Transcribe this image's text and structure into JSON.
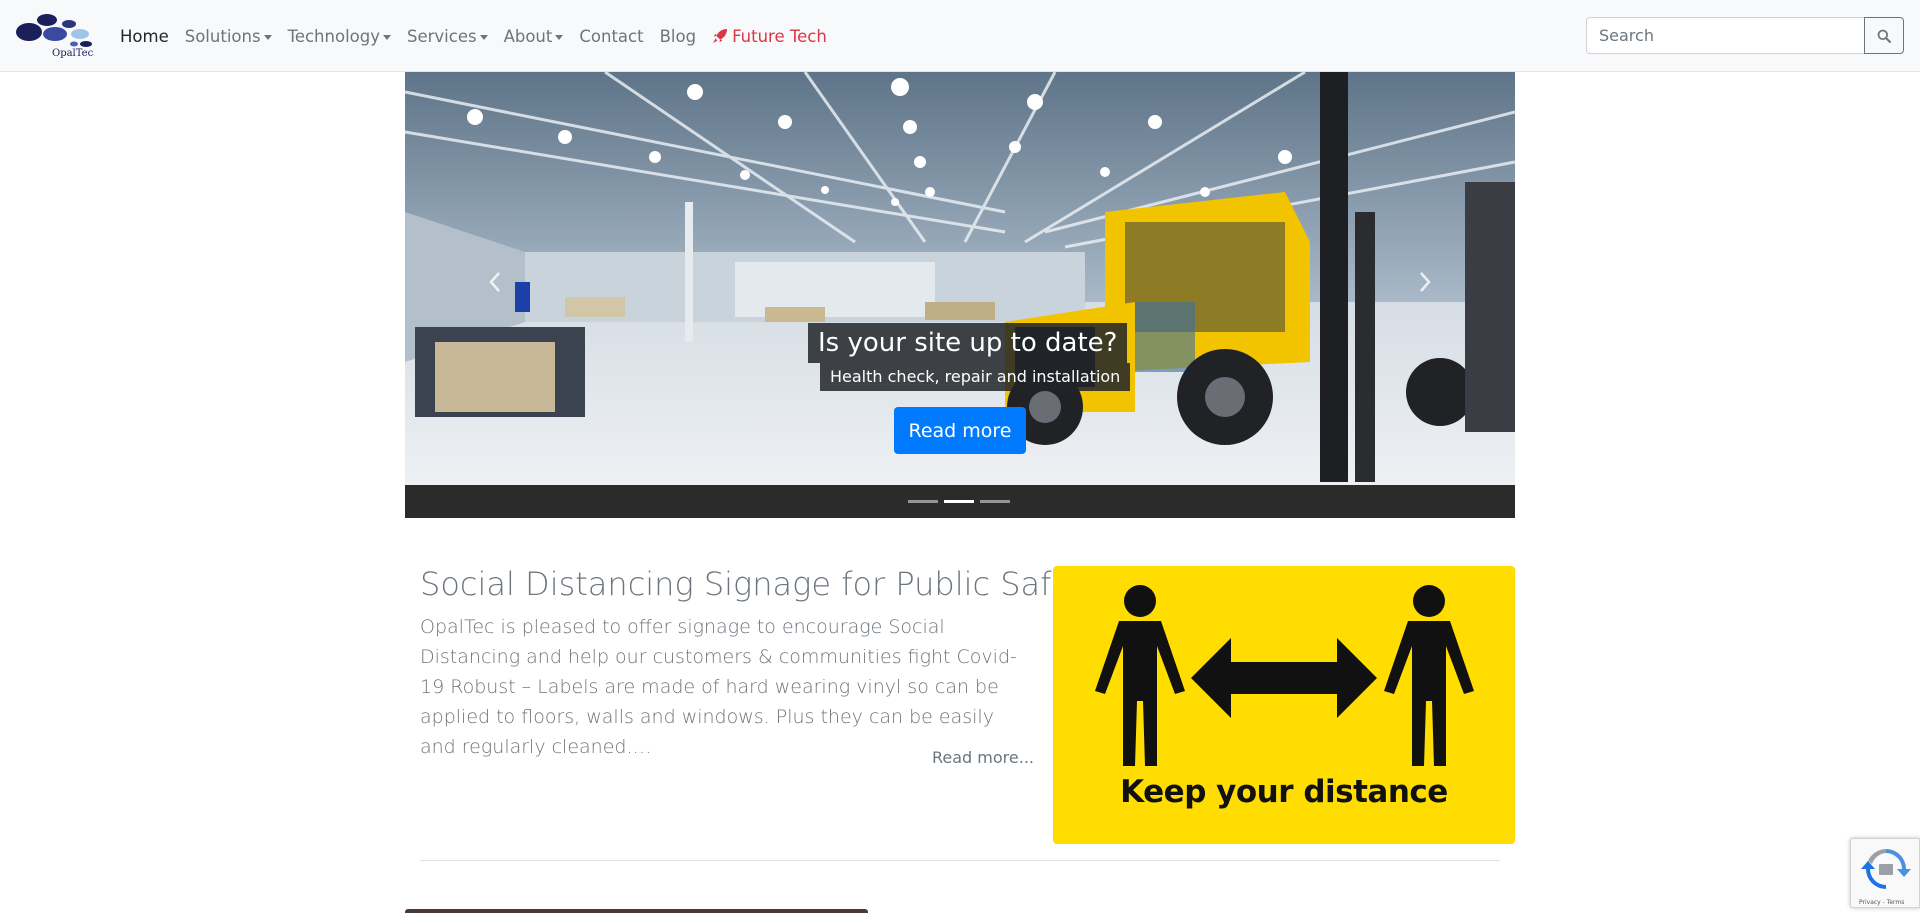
{
  "brand": {
    "name": "OpalTec"
  },
  "nav": {
    "items": [
      {
        "label": "Home",
        "active": true,
        "dropdown": false
      },
      {
        "label": "Solutions",
        "active": false,
        "dropdown": true
      },
      {
        "label": "Technology",
        "active": false,
        "dropdown": true
      },
      {
        "label": "Services",
        "active": false,
        "dropdown": true
      },
      {
        "label": "About",
        "active": false,
        "dropdown": true
      },
      {
        "label": "Contact",
        "active": false,
        "dropdown": false
      },
      {
        "label": "Blog",
        "active": false,
        "dropdown": false
      }
    ],
    "future": {
      "label": "Future Tech",
      "icon": "rocket-icon",
      "color": "#dc3545"
    }
  },
  "search": {
    "placeholder": "Search",
    "button_icon": "search-icon"
  },
  "carousel": {
    "caption_title": "Is your site up to date?",
    "caption_subtitle": "Health check, repair and installation",
    "button_label": "Read more",
    "slide_count": 3,
    "active_slide": 2
  },
  "article": {
    "title": "Social Distancing Signage for Public Safety",
    "body": "OpalTec is pleased to offer signage to encourage Social Distancing and help our customers & communities fight Covid-19 Robust –  Labels are made of hard wearing vinyl so can be applied to floors, walls and windows. Plus they can be easily and regularly cleaned.…",
    "read_more": "Read more...",
    "sign_text": "Keep your distance"
  },
  "recaptcha": {
    "links": "Privacy - Terms"
  },
  "colors": {
    "primary": "#007bff",
    "accent": "#dc3545",
    "sign_yellow": "#ffdd00",
    "navbar_bg": "#f8f9fa"
  }
}
